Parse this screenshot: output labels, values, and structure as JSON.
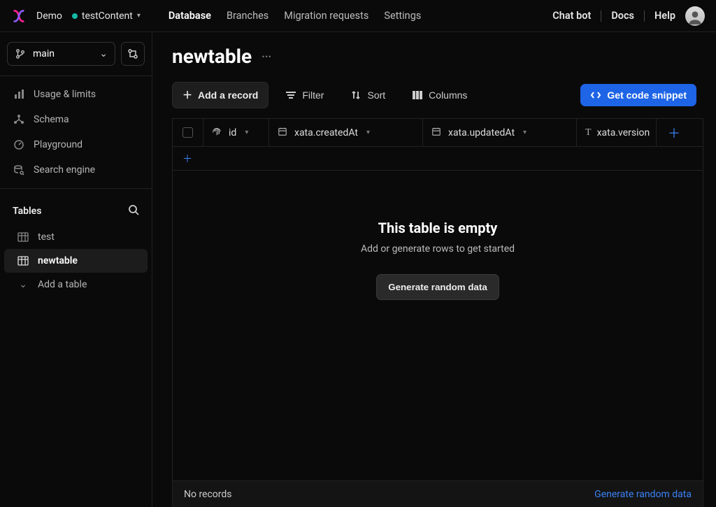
{
  "header": {
    "workspace": "Demo",
    "db": "testContent",
    "tabs": [
      "Database",
      "Branches",
      "Migration requests",
      "Settings"
    ],
    "active_tab": "Database",
    "right_links": {
      "chat": "Chat bot",
      "docs": "Docs",
      "help": "Help"
    }
  },
  "sidebar": {
    "branch": "main",
    "nav": [
      {
        "label": "Usage & limits",
        "icon": "bar-chart-icon"
      },
      {
        "label": "Schema",
        "icon": "nodes-icon"
      },
      {
        "label": "Playground",
        "icon": "gauge-icon"
      },
      {
        "label": "Search engine",
        "icon": "search-db-icon"
      }
    ],
    "tables_header": "Tables",
    "tables": [
      {
        "label": "test",
        "active": false
      },
      {
        "label": "newtable",
        "active": true
      }
    ],
    "add_table": "Add a table"
  },
  "page": {
    "title": "newtable",
    "toolbar": {
      "add_record": "Add a record",
      "filter": "Filter",
      "sort": "Sort",
      "columns": "Columns",
      "code": "Get code snippet"
    },
    "columns": {
      "id": "id",
      "created": "xata.createdAt",
      "updated": "xata.updatedAt",
      "version": "xata.version"
    },
    "empty": {
      "title": "This table is empty",
      "sub": "Add or generate rows to get started",
      "button": "Generate random data"
    },
    "footer": {
      "status": "No records",
      "link": "Generate random data"
    }
  }
}
